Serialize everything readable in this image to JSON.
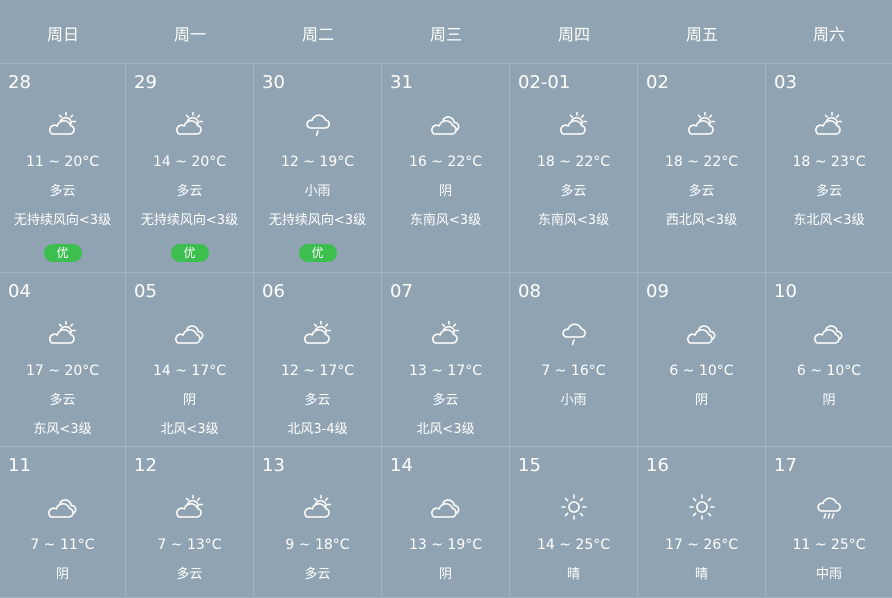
{
  "weekdays": [
    "周日",
    "周一",
    "周二",
    "周三",
    "周四",
    "周五",
    "周六"
  ],
  "days": [
    {
      "date": "28",
      "icon": "partly-cloudy-icon",
      "temp": "11 ~ 20°C",
      "cond": "多云",
      "wind": "无持续风向<3级",
      "aqi": "优"
    },
    {
      "date": "29",
      "icon": "partly-cloudy-icon",
      "temp": "14 ~ 20°C",
      "cond": "多云",
      "wind": "无持续风向<3级",
      "aqi": "优"
    },
    {
      "date": "30",
      "icon": "light-rain-icon",
      "temp": "12 ~ 19°C",
      "cond": "小雨",
      "wind": "无持续风向<3级",
      "aqi": "优"
    },
    {
      "date": "31",
      "icon": "overcast-icon",
      "temp": "16 ~ 22°C",
      "cond": "阴",
      "wind": "东南风<3级"
    },
    {
      "date": "02-01",
      "icon": "partly-cloudy-icon",
      "temp": "18 ~ 22°C",
      "cond": "多云",
      "wind": "东南风<3级"
    },
    {
      "date": "02",
      "icon": "partly-cloudy-icon",
      "temp": "18 ~ 22°C",
      "cond": "多云",
      "wind": "西北风<3级"
    },
    {
      "date": "03",
      "icon": "partly-cloudy-icon",
      "temp": "18 ~ 23°C",
      "cond": "多云",
      "wind": "东北风<3级"
    },
    {
      "date": "04",
      "icon": "partly-cloudy-icon",
      "temp": "17 ~ 20°C",
      "cond": "多云",
      "wind": "东风<3级"
    },
    {
      "date": "05",
      "icon": "overcast-icon",
      "temp": "14 ~ 17°C",
      "cond": "阴",
      "wind": "北风<3级"
    },
    {
      "date": "06",
      "icon": "partly-cloudy-icon",
      "temp": "12 ~ 17°C",
      "cond": "多云",
      "wind": "北风3-4级"
    },
    {
      "date": "07",
      "icon": "partly-cloudy-icon",
      "temp": "13 ~ 17°C",
      "cond": "多云",
      "wind": "北风<3级"
    },
    {
      "date": "08",
      "icon": "light-rain-icon",
      "temp": "7 ~ 16°C",
      "cond": "小雨"
    },
    {
      "date": "09",
      "icon": "overcast-icon",
      "temp": "6 ~ 10°C",
      "cond": "阴"
    },
    {
      "date": "10",
      "icon": "overcast-icon",
      "temp": "6 ~ 10°C",
      "cond": "阴"
    },
    {
      "date": "11",
      "icon": "overcast-icon",
      "temp": "7 ~ 11°C",
      "cond": "阴"
    },
    {
      "date": "12",
      "icon": "partly-cloudy-icon",
      "temp": "7 ~ 13°C",
      "cond": "多云"
    },
    {
      "date": "13",
      "icon": "partly-cloudy-icon",
      "temp": "9 ~ 18°C",
      "cond": "多云"
    },
    {
      "date": "14",
      "icon": "overcast-icon",
      "temp": "13 ~ 19°C",
      "cond": "阴"
    },
    {
      "date": "15",
      "icon": "sunny-icon",
      "temp": "14 ~ 25°C",
      "cond": "晴"
    },
    {
      "date": "16",
      "icon": "sunny-icon",
      "temp": "17 ~ 26°C",
      "cond": "晴"
    },
    {
      "date": "17",
      "icon": "moderate-rain-icon",
      "temp": "11 ~ 25°C",
      "cond": "中雨"
    }
  ],
  "colors": {
    "background": "#8fa3b2",
    "grid_line": "#a3b3c1",
    "text": "#ffffff",
    "aqi_good": "#3dbf4f"
  }
}
